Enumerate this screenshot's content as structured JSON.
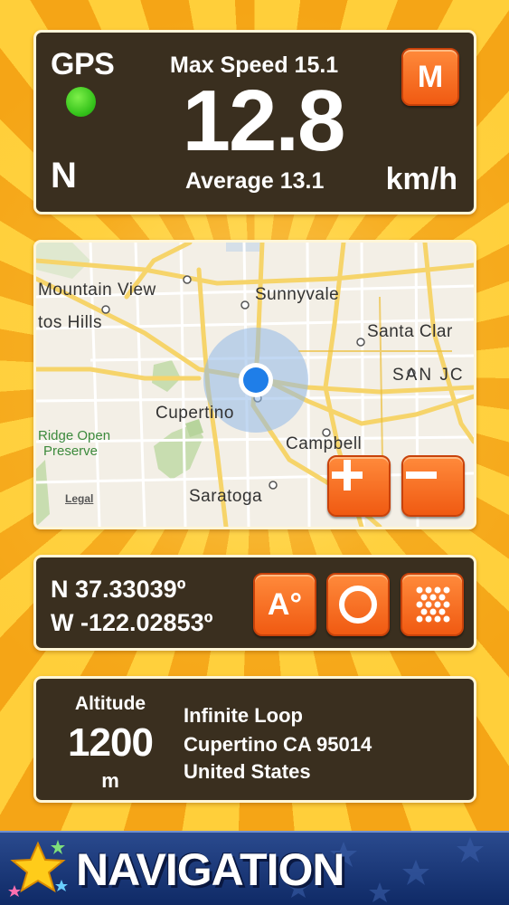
{
  "speed": {
    "gps_label": "GPS",
    "heading": "N",
    "max_speed": "Max Speed 15.1",
    "current_speed": "12.8",
    "average": "Average 13.1",
    "unit": "km/h",
    "mode_button": "M",
    "gps_status_color": "#34c21a"
  },
  "map": {
    "labels": {
      "mountain_view": "Mountain View",
      "los_altos_hills": "tos Hills",
      "sunnyvale": "Sunnyvale",
      "santa_clara": "Santa Clar",
      "san_jose": "SAN JC",
      "cupertino": "Cupertino",
      "ridge_open": "Ridge Open",
      "preserve": "Preserve",
      "campbell": "Campbell",
      "saratoga": "Saratoga"
    },
    "legal": "Legal",
    "zoom_in": "+",
    "zoom_out": "−",
    "location_color": "#1f7ee8"
  },
  "coords": {
    "latitude": "N 37.33039º",
    "longitude": "W -122.02853º",
    "accuracy_button": "A°"
  },
  "altitude": {
    "label": "Altitude",
    "value": "1200",
    "unit": "m",
    "address": [
      "Infinite Loop",
      "Cupertino CA 95014",
      "United States"
    ]
  },
  "nav": {
    "title": "NAVIGATION"
  },
  "colors": {
    "accent": "#f05a12",
    "panel": "#3a2f1f",
    "nav_bar": "#1a3777"
  }
}
